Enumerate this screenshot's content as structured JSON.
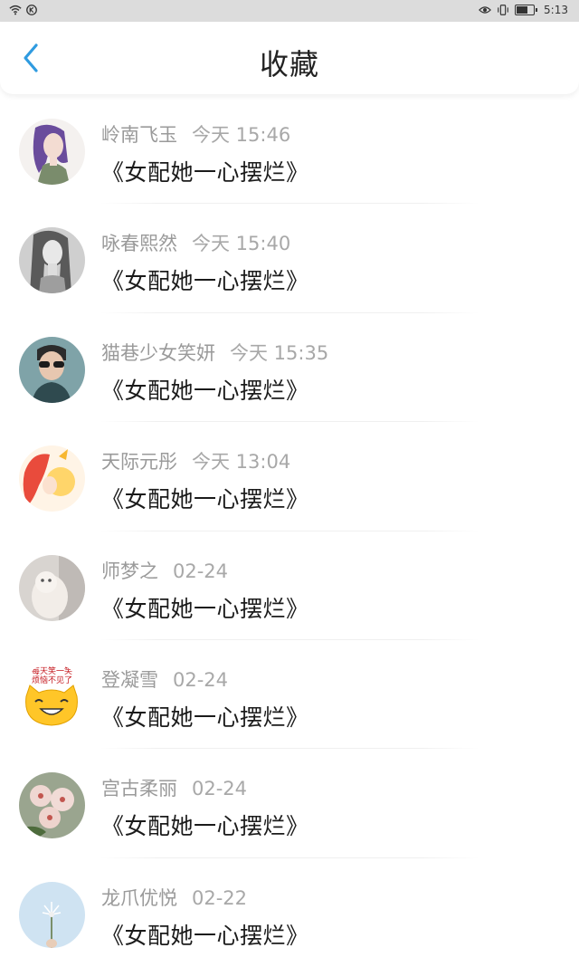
{
  "status_bar": {
    "time": "5:13",
    "left_icons": [
      "wifi-icon",
      "no-sim-icon"
    ],
    "right_icons": [
      "eye-icon",
      "vibrate-icon",
      "battery-icon"
    ]
  },
  "header": {
    "title": "收藏",
    "back_icon": "chevron-left-icon",
    "accent_color": "#2f9be0"
  },
  "favorites": [
    {
      "user": "岭南飞玉",
      "time": "今天 15:46",
      "book": "《女配她一心摆烂》",
      "avatar": "anime-girl-avatar"
    },
    {
      "user": "咏春熙然",
      "time": "今天 15:40",
      "book": "《女配她一心摆烂》",
      "avatar": "woman-bw-avatar"
    },
    {
      "user": "猫巷少女笑妍",
      "time": "今天 15:35",
      "book": "《女配她一心摆烂》",
      "avatar": "boy-sunglasses-avatar"
    },
    {
      "user": "天际元彤",
      "time": "今天 13:04",
      "book": "《女配她一心摆烂》",
      "avatar": "anime-redhair-avatar"
    },
    {
      "user": "师梦之",
      "time": "02-24",
      "book": "《女配她一心摆烂》",
      "avatar": "cat-photo-avatar"
    },
    {
      "user": "登凝雪",
      "time": "02-24",
      "book": "《女配她一心摆烂》",
      "avatar": "smiley-cat-avatar"
    },
    {
      "user": "宫古柔丽",
      "time": "02-24",
      "book": "《女配她一心摆烂》",
      "avatar": "flowers-avatar"
    },
    {
      "user": "龙爪优悦",
      "time": "02-22",
      "book": "《女配她一心摆烂》",
      "avatar": "dandelion-avatar"
    }
  ],
  "avatar_text": {
    "smiley_top": "每天笑一笑",
    "smiley_bottom": "烦恼不见了"
  }
}
